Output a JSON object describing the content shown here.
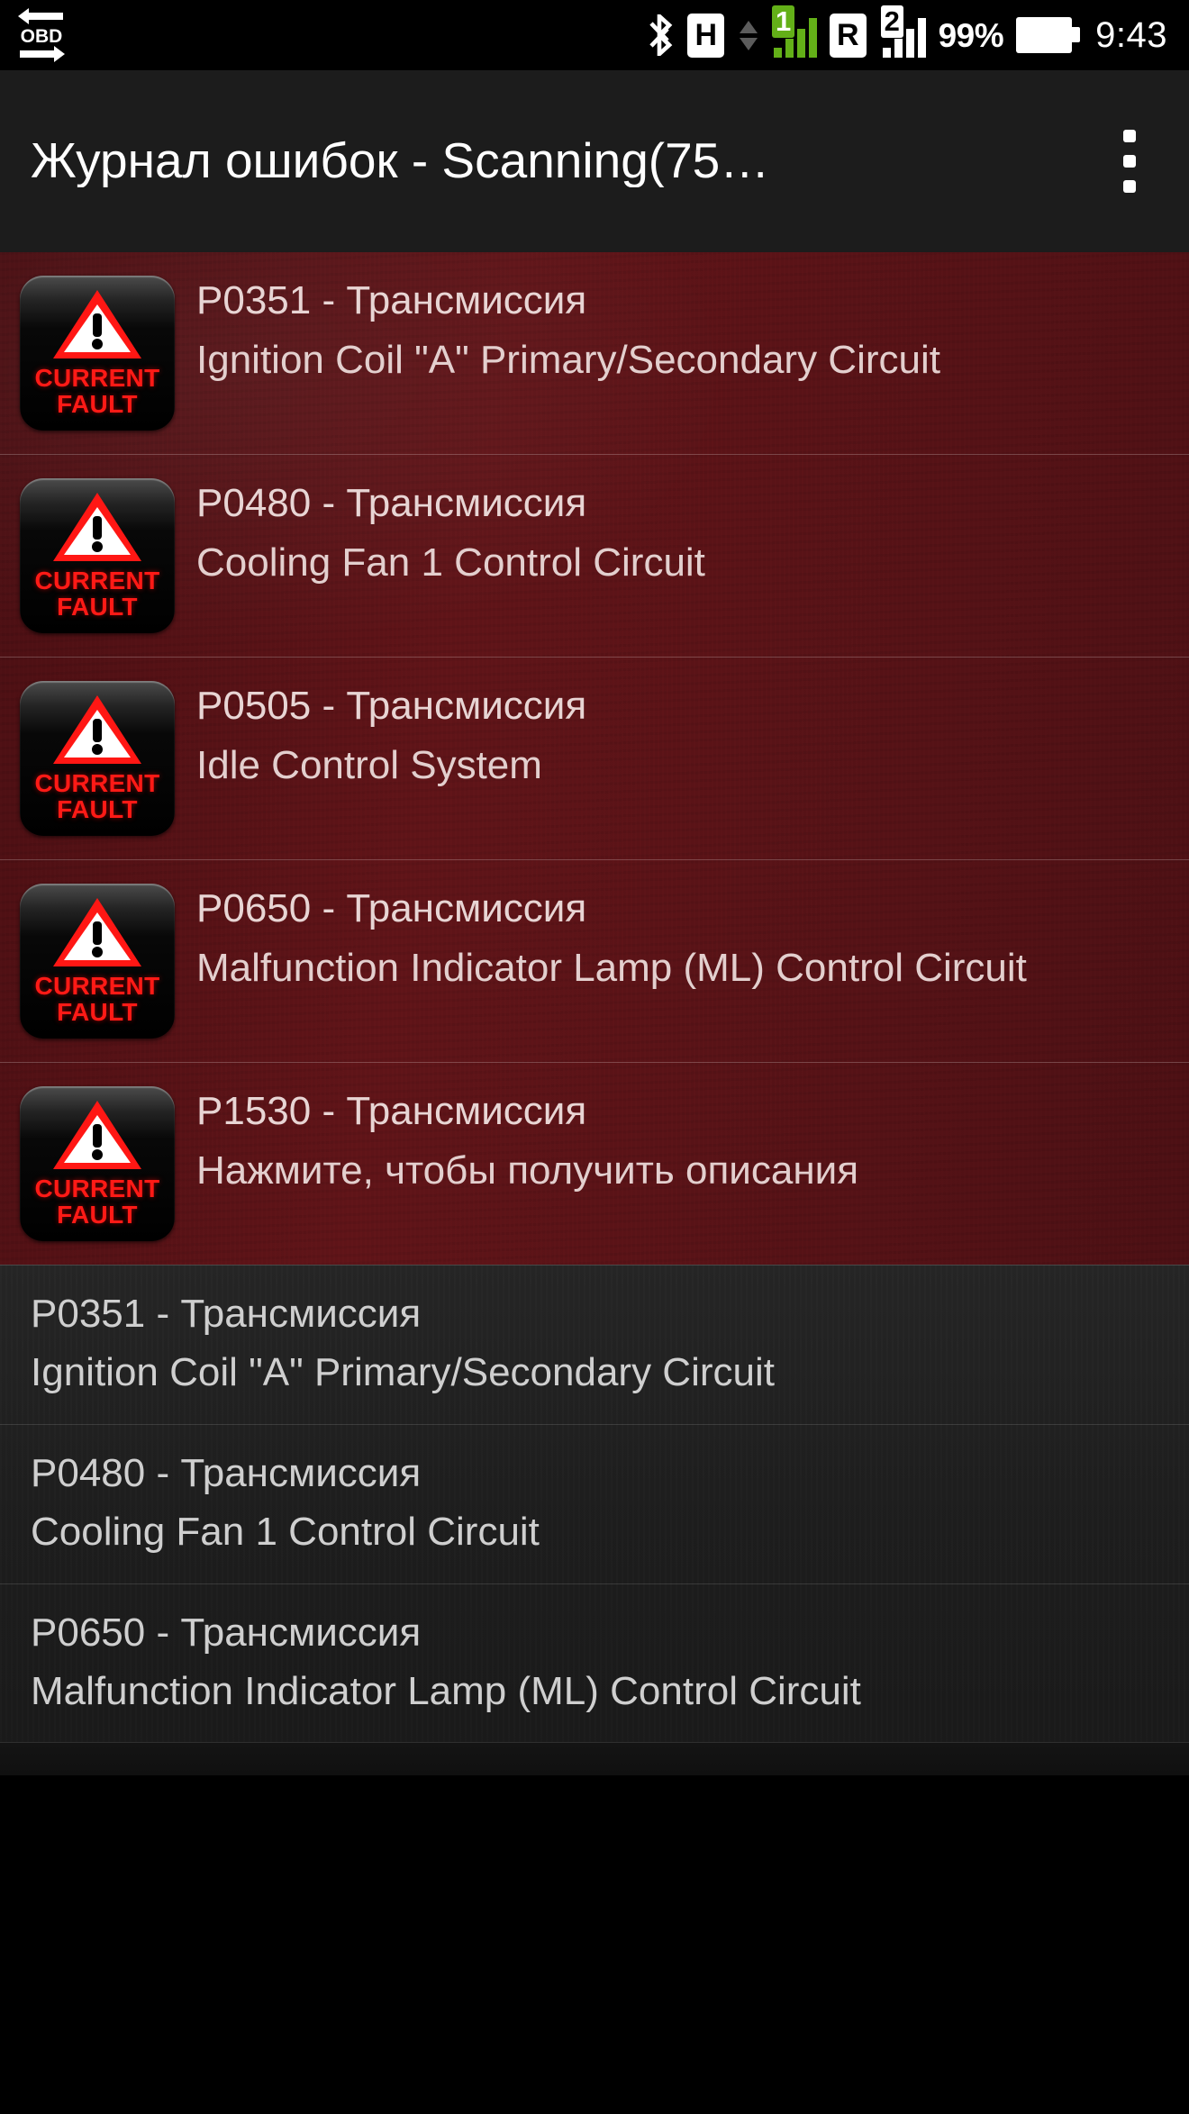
{
  "status_bar": {
    "obd_icon_label": "OBD",
    "bluetooth_icon": "bluetooth-icon",
    "network_type_1": "H",
    "sim_1_number": "1",
    "network_type_2": "R",
    "sim_2_number": "2",
    "battery_percent": "99%",
    "clock": "9:43",
    "colors": {
      "signal_active": "#63b018",
      "signal_inactive": "#ffffff",
      "background": "#000000"
    }
  },
  "app_bar": {
    "title": "Журнал ошибок - Scanning(75…",
    "overflow_menu": "more-options",
    "background": "#1c1c1c"
  },
  "current_faults": {
    "badge_line_1": "CURRENT",
    "badge_line_2": "FAULT",
    "accent_color": "#ff1a16",
    "background_color": "#5a1317",
    "items": [
      {
        "code": "P0351 - Трансмиссия",
        "description": "Ignition Coil \"A\" Primary/Secondary Circuit"
      },
      {
        "code": "P0480 - Трансмиссия",
        "description": "Cooling Fan 1 Control Circuit"
      },
      {
        "code": "P0505 - Трансмиссия",
        "description": "Idle Control System"
      },
      {
        "code": "P0650 - Трансмиссия",
        "description": "Malfunction Indicator Lamp (ML) Control Circuit"
      },
      {
        "code": "P1530 - Трансмиссия",
        "description": "Нажмите, чтобы получить описания"
      }
    ]
  },
  "history": {
    "background_color": "#1e1e1e",
    "items": [
      {
        "code": "P0351 - Трансмиссия",
        "description": "Ignition Coil \"A\" Primary/Secondary Circuit"
      },
      {
        "code": "P0480 - Трансмиссия",
        "description": "Cooling Fan 1 Control Circuit"
      },
      {
        "code": "P0650 - Трансмиссия",
        "description": "Malfunction Indicator Lamp (ML) Control Circuit"
      }
    ]
  }
}
